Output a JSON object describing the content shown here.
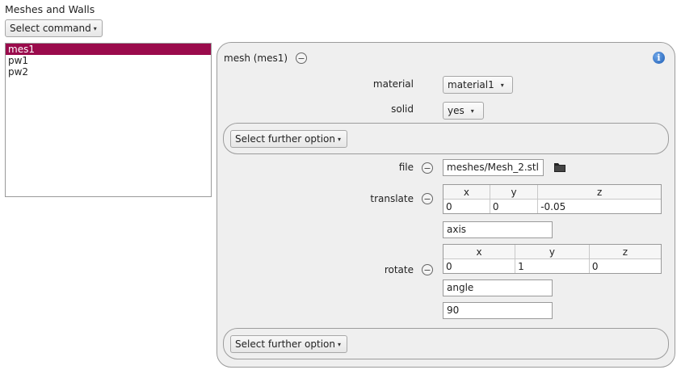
{
  "window": {
    "title": "Meshes and Walls"
  },
  "toolbar": {
    "command_label": "Select command"
  },
  "mesh_list": {
    "items": [
      "mes1",
      "pw1",
      "pw2"
    ],
    "selected": "mes1"
  },
  "panel": {
    "header": "mesh (mes1)",
    "material": {
      "label": "material",
      "value": "material1"
    },
    "solid": {
      "label": "solid",
      "value": "yes"
    },
    "further_option_1": "Select further option",
    "file": {
      "label": "file",
      "value": "meshes/Mesh_2.stl"
    },
    "translate": {
      "label": "translate",
      "columns": [
        "x",
        "y",
        "z"
      ],
      "values": [
        "0",
        "0",
        "-0.05"
      ]
    },
    "rotate": {
      "label": "rotate",
      "axis_label": "axis",
      "columns": [
        "x",
        "y",
        "z"
      ],
      "axis_values": [
        "0",
        "1",
        "0"
      ],
      "angle_label": "angle",
      "angle_value": "90"
    },
    "further_option_2": "Select further option"
  },
  "icons": {
    "info": "info-icon",
    "folder": "folder-icon",
    "collapse": "minus-circle-icon"
  }
}
